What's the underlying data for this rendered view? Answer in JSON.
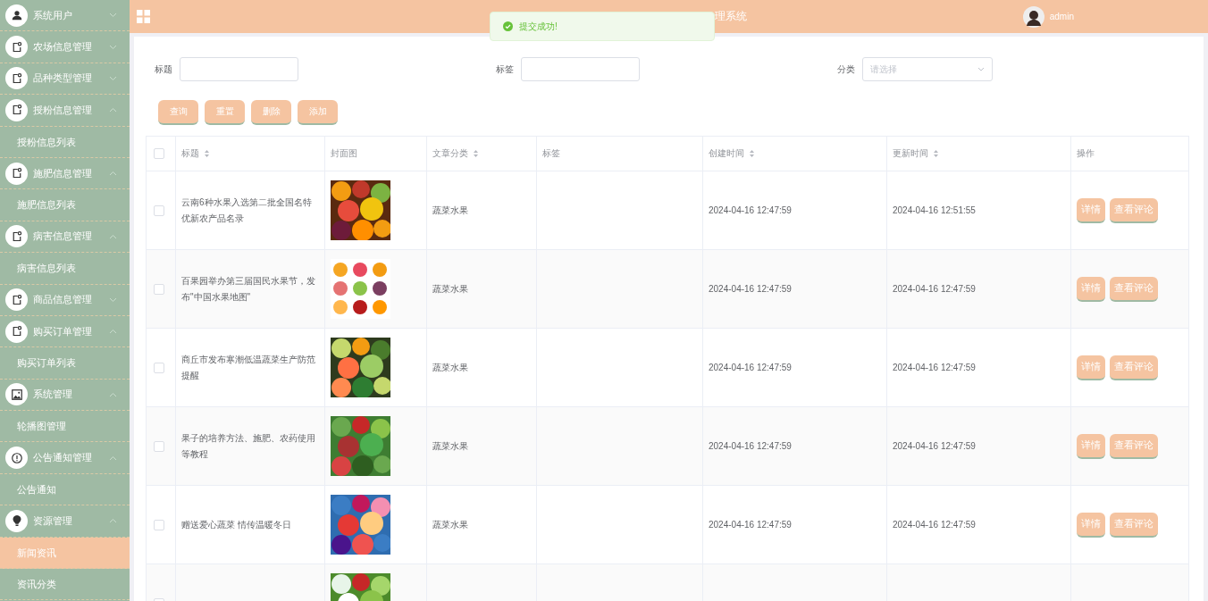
{
  "sidebar": {
    "groups": [
      {
        "label": "系统用户",
        "expanded": false
      },
      {
        "label": "农场信息管理",
        "expanded": false
      },
      {
        "label": "品种类型管理",
        "expanded": false
      },
      {
        "label": "授粉信息管理",
        "expanded": true,
        "children": [
          {
            "label": "授粉信息列表",
            "selected": false
          }
        ]
      },
      {
        "label": "施肥信息管理",
        "expanded": true,
        "children": [
          {
            "label": "施肥信息列表",
            "selected": false
          }
        ]
      },
      {
        "label": "病害信息管理",
        "expanded": true,
        "children": [
          {
            "label": "病害信息列表",
            "selected": false
          }
        ]
      },
      {
        "label": "商品信息管理",
        "expanded": false
      },
      {
        "label": "购买订单管理",
        "expanded": true,
        "children": [
          {
            "label": "购买订单列表",
            "selected": false
          }
        ]
      },
      {
        "label": "系统管理",
        "expanded": true,
        "children": [
          {
            "label": "轮播图管理",
            "selected": false
          }
        ]
      },
      {
        "label": "公告通知管理",
        "expanded": true,
        "children": [
          {
            "label": "公告通知",
            "selected": false
          }
        ]
      },
      {
        "label": "资源管理",
        "expanded": true,
        "children": [
          {
            "label": "新闻资讯",
            "selected": true
          },
          {
            "label": "资讯分类",
            "selected": false
          }
        ]
      }
    ]
  },
  "header": {
    "title_visible_part": "理系统",
    "user": "admin"
  },
  "toast": {
    "message": "提交成功!"
  },
  "search": {
    "fields": [
      {
        "label": "标题",
        "kind": "text"
      },
      {
        "label": "标签",
        "kind": "text"
      },
      {
        "label": "分类",
        "kind": "select",
        "placeholder": "请选择"
      }
    ],
    "buttons": [
      "查询",
      "重置",
      "删除",
      "添加"
    ]
  },
  "table": {
    "all_checked": false,
    "columns": [
      {
        "label": "标题",
        "sortable": true
      },
      {
        "label": "封面图",
        "sortable": false
      },
      {
        "label": "文章分类",
        "sortable": true
      },
      {
        "label": "标签",
        "sortable": false
      },
      {
        "label": "创建时间",
        "sortable": true
      },
      {
        "label": "更新时间",
        "sortable": true
      },
      {
        "label": "操作",
        "sortable": false
      }
    ],
    "rows": [
      {
        "checked": false,
        "title": "云南6种水果入选第二批全国名特优新农产品名录",
        "category": "蔬菜水果",
        "created": "2024-04-16 12:47:59",
        "updated": "2024-04-16 12:51:55",
        "actions": [
          "详情",
          "查看评论"
        ]
      },
      {
        "checked": false,
        "title": "百果园举办第三届国民水果节，发布\"中国水果地图\"",
        "category": "蔬菜水果",
        "created": "2024-04-16 12:47:59",
        "updated": "2024-04-16 12:47:59",
        "actions": [
          "详情",
          "查看评论"
        ]
      },
      {
        "checked": false,
        "title": "商丘市发布寒潮低温蔬菜生产防范提醒",
        "category": "蔬菜水果",
        "created": "2024-04-16 12:47:59",
        "updated": "2024-04-16 12:47:59",
        "actions": [
          "详情",
          "查看评论"
        ]
      },
      {
        "checked": false,
        "title": "果子的培养方法、施肥、农药使用等教程",
        "category": "蔬菜水果",
        "created": "2024-04-16 12:47:59",
        "updated": "2024-04-16 12:47:59",
        "actions": [
          "详情",
          "查看评论"
        ]
      },
      {
        "checked": false,
        "title": "赠送爱心蔬菜 情传温暖冬日",
        "category": "蔬菜水果",
        "created": "2024-04-16 12:47:59",
        "updated": "2024-04-16 12:47:59",
        "actions": [
          "详情",
          "查看评论"
        ]
      },
      {
        "kind": "partial",
        "checked": false
      }
    ]
  }
}
